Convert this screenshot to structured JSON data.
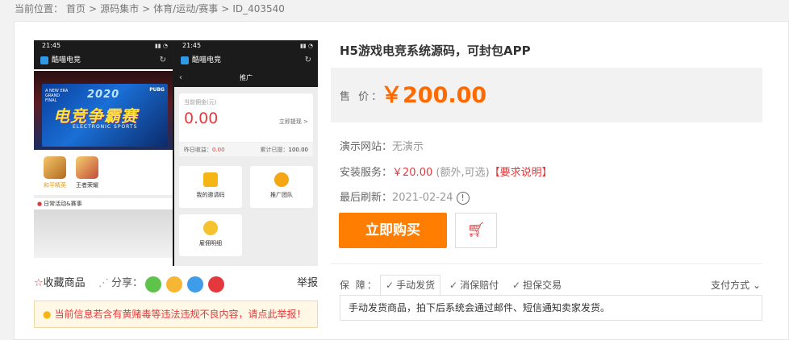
{
  "breadcrumb": {
    "prefix": "当前位置：",
    "items": [
      "首页",
      "源码集市",
      "体育/运动/赛事",
      "ID_403540"
    ],
    "sep": ">"
  },
  "screenshot": {
    "left_phone": {
      "time": "21:45",
      "app_name": "酷喵电竞",
      "banner_year": "2020",
      "banner_title": "电竞争霸赛",
      "banner_sub": "ELECTRONIC SPORTS",
      "banner_brand": "PUBG",
      "banner_tag": "A NEW ERA GRAND FINAL",
      "games": [
        "和平精英",
        "王者荣耀"
      ],
      "daily": "日常活动&赛事"
    },
    "right_phone": {
      "time": "21:45",
      "app_name": "酷喵电竞",
      "page_title": "推广",
      "balance_label": "当前佣金(元)",
      "balance": "0.00",
      "withdraw": "立即提现 >",
      "yesterday_label": "昨日收益：",
      "yesterday_value": "0.00",
      "total_label": "累计已提：",
      "total_value": "100.00",
      "tiles": [
        "我的邀请码",
        "推广团队",
        "雇佣明细"
      ]
    }
  },
  "actions": {
    "favorite": "收藏商品",
    "share": "分享：",
    "report": "举报"
  },
  "notice": "当前信息若含有黄赌毒等违法违规不良内容，请点此举报！",
  "product": {
    "title": "H5游戏电竞系统源码，可封包APP",
    "price_label": "售 价：",
    "price": "￥200.00",
    "demo_label": "演示网站：",
    "demo_value": "无演示",
    "install_label": "安装服务：",
    "install_price": "￥20.00",
    "install_note": "(额外,可选)",
    "install_link": "【要求说明】",
    "refresh_label": "最后刷新：",
    "refresh_date": "2021-02-24",
    "buy_button": "立即购买"
  },
  "guarantee": {
    "label": "保 障：",
    "tabs": [
      "手动发货",
      "消保赔付",
      "担保交易"
    ],
    "pay_method": "支付方式",
    "description": "手动发货商品，拍下后系统会通过邮件、短信通知卖家发货。"
  },
  "colors": {
    "accent_orange": "#ff7d00",
    "price_orange": "#ff6a00",
    "alert_red": "#e4393c"
  }
}
